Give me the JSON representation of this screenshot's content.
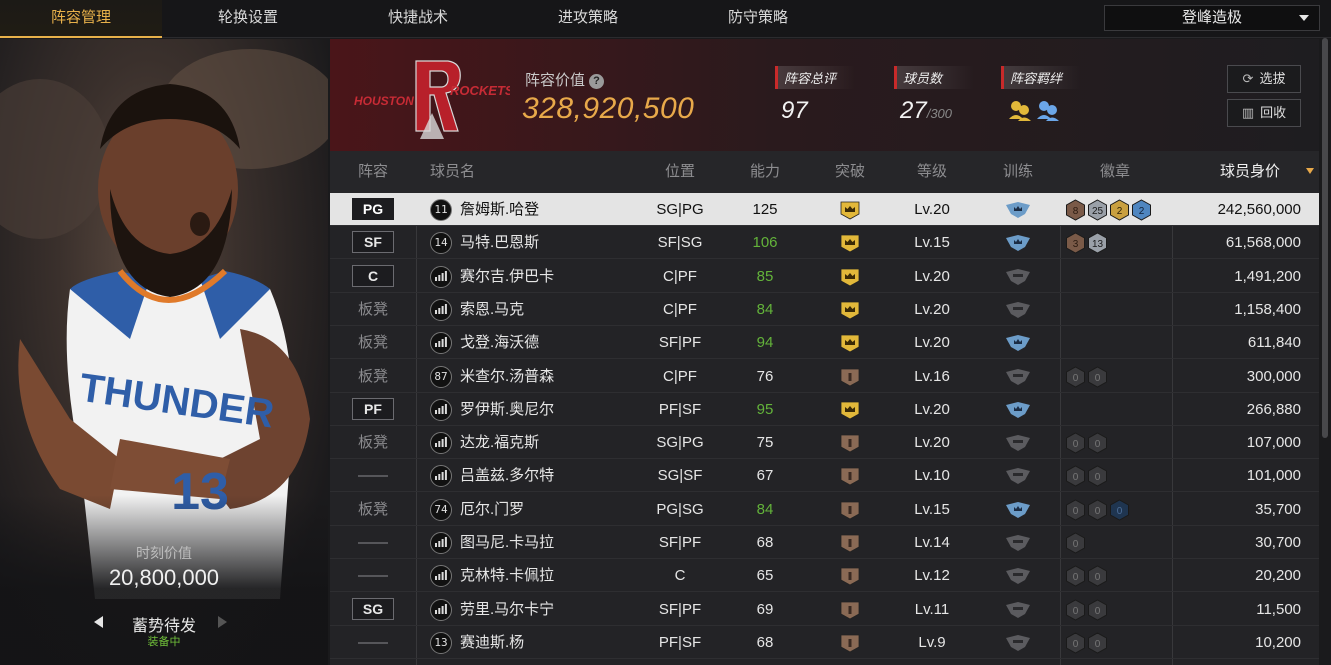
{
  "nav": {
    "tabs": [
      {
        "label": "阵容管理",
        "active": true
      },
      {
        "label": "轮换设置",
        "active": false
      },
      {
        "label": "快捷战术",
        "active": false
      },
      {
        "label": "进攻策略",
        "active": false
      },
      {
        "label": "防守策略",
        "active": false
      }
    ],
    "dropdown": "登峰造极"
  },
  "card": {
    "moment_value_label": "时刻价值",
    "moment_value": "20,800,000",
    "skill": "蓄势待发",
    "equipped": "装备中",
    "jersey_text": "THUNDER",
    "jersey_number": "13"
  },
  "team": {
    "logo_text_left": "HOUSTON",
    "logo_text_right": "ROCKETS",
    "lineup_value_label": "阵容价值",
    "lineup_value": "328,920,500",
    "overall_label": "阵容总评",
    "overall": "97",
    "players_label": "球员数",
    "players": "27",
    "players_max": "/300",
    "bond_label": "阵容羁绊",
    "btn_draft": "选拔",
    "btn_recycle": "回收"
  },
  "table": {
    "headers": [
      "阵容",
      "球员名",
      "位置",
      "能力",
      "突破",
      "等级",
      "训练",
      "徽章",
      "球员身价"
    ],
    "rows": [
      {
        "lineup": "PG",
        "badge": true,
        "jersey": "11",
        "name": "詹姆斯.哈登",
        "pos": "SG|PG",
        "ability": "125",
        "green": false,
        "breakthrough": "gold",
        "level": "Lv.20",
        "training": "blue",
        "badges": [
          {
            "t": "8",
            "k": "bronze"
          },
          {
            "t": "25",
            "k": "silver"
          },
          {
            "t": "2",
            "k": "gold"
          },
          {
            "t": "2",
            "k": "blue"
          }
        ],
        "value": "242,560,000"
      },
      {
        "lineup": "SF",
        "badge": true,
        "jersey": "14",
        "name": "马特.巴恩斯",
        "pos": "SF|SG",
        "ability": "106",
        "green": true,
        "breakthrough": "gold",
        "level": "Lv.15",
        "training": "blue",
        "badges": [
          {
            "t": "3",
            "k": "bronze"
          },
          {
            "t": "13",
            "k": "silver"
          }
        ],
        "value": "61,568,000"
      },
      {
        "lineup": "C",
        "badge": true,
        "jersey": "",
        "name": "赛尔吉.伊巴卡",
        "pos": "C|PF",
        "ability": "85",
        "green": true,
        "breakthrough": "gold",
        "level": "Lv.20",
        "training": "grey",
        "badges": [],
        "value": "1,491,200"
      },
      {
        "lineup": "板凳",
        "badge": false,
        "jersey": "",
        "name": "索恩.马克",
        "pos": "C|PF",
        "ability": "84",
        "green": true,
        "breakthrough": "gold",
        "level": "Lv.20",
        "training": "grey",
        "badges": [],
        "value": "1,158,400"
      },
      {
        "lineup": "板凳",
        "badge": false,
        "jersey": "",
        "name": "戈登.海沃德",
        "pos": "SF|PF",
        "ability": "94",
        "green": true,
        "breakthrough": "gold",
        "level": "Lv.20",
        "training": "blue",
        "badges": [],
        "value": "611,840"
      },
      {
        "lineup": "板凳",
        "badge": false,
        "jersey": "87",
        "name": "米查尔.汤普森",
        "pos": "C|PF",
        "ability": "76",
        "green": false,
        "breakthrough": "brown",
        "level": "Lv.16",
        "training": "grey",
        "badges": [
          {
            "t": "0",
            "k": "dark"
          },
          {
            "t": "0",
            "k": "dark"
          }
        ],
        "value": "300,000"
      },
      {
        "lineup": "PF",
        "badge": true,
        "jersey": "",
        "name": "罗伊斯.奥尼尔",
        "pos": "PF|SF",
        "ability": "95",
        "green": true,
        "breakthrough": "gold",
        "level": "Lv.20",
        "training": "blue",
        "badges": [],
        "value": "266,880"
      },
      {
        "lineup": "板凳",
        "badge": false,
        "jersey": "",
        "name": "达龙.福克斯",
        "pos": "SG|PG",
        "ability": "75",
        "green": false,
        "breakthrough": "brown",
        "level": "Lv.20",
        "training": "grey",
        "badges": [
          {
            "t": "0",
            "k": "dark"
          },
          {
            "t": "0",
            "k": "dark"
          }
        ],
        "value": "107,000"
      },
      {
        "lineup": "——",
        "badge": false,
        "jersey": "",
        "name": "吕盖兹.多尔特",
        "pos": "SG|SF",
        "ability": "67",
        "green": false,
        "breakthrough": "brown",
        "level": "Lv.10",
        "training": "grey",
        "badges": [
          {
            "t": "0",
            "k": "dark"
          },
          {
            "t": "0",
            "k": "dark"
          }
        ],
        "value": "101,000"
      },
      {
        "lineup": "板凳",
        "badge": false,
        "jersey": "74",
        "name": "厄尔.门罗",
        "pos": "PG|SG",
        "ability": "84",
        "green": true,
        "breakthrough": "brown",
        "level": "Lv.15",
        "training": "blue",
        "badges": [
          {
            "t": "0",
            "k": "dark"
          },
          {
            "t": "0",
            "k": "dark"
          },
          {
            "t": "0",
            "k": "darkblue"
          }
        ],
        "value": "35,700"
      },
      {
        "lineup": "——",
        "badge": false,
        "jersey": "",
        "name": "图马尼.卡马拉",
        "pos": "SF|PF",
        "ability": "68",
        "green": false,
        "breakthrough": "brown",
        "level": "Lv.14",
        "training": "grey",
        "badges": [
          {
            "t": "0",
            "k": "dark"
          }
        ],
        "value": "30,700"
      },
      {
        "lineup": "——",
        "badge": false,
        "jersey": "",
        "name": "克林特.卡佩拉",
        "pos": "C",
        "ability": "65",
        "green": false,
        "breakthrough": "brown",
        "level": "Lv.12",
        "training": "grey",
        "badges": [
          {
            "t": "0",
            "k": "dark"
          },
          {
            "t": "0",
            "k": "dark"
          }
        ],
        "value": "20,200"
      },
      {
        "lineup": "SG",
        "badge": true,
        "jersey": "",
        "name": "劳里.马尔卡宁",
        "pos": "SF|PF",
        "ability": "69",
        "green": false,
        "breakthrough": "brown",
        "level": "Lv.11",
        "training": "grey",
        "badges": [
          {
            "t": "0",
            "k": "dark"
          },
          {
            "t": "0",
            "k": "dark"
          }
        ],
        "value": "11,500"
      },
      {
        "lineup": "——",
        "badge": false,
        "jersey": "13",
        "name": "赛迪斯.杨",
        "pos": "PF|SF",
        "ability": "68",
        "green": false,
        "breakthrough": "brown",
        "level": "Lv.9",
        "training": "grey",
        "badges": [
          {
            "t": "0",
            "k": "dark"
          },
          {
            "t": "0",
            "k": "dark"
          }
        ],
        "value": "10,200"
      }
    ]
  },
  "colors": {
    "accent": "#e8a94a",
    "ability_green": "#63b33a",
    "breakthrough_gold": "#e2b83a",
    "breakthrough_brown": "#8a6a55",
    "training_blue": "#6c9cc8",
    "training_grey": "#5b5b5f"
  }
}
